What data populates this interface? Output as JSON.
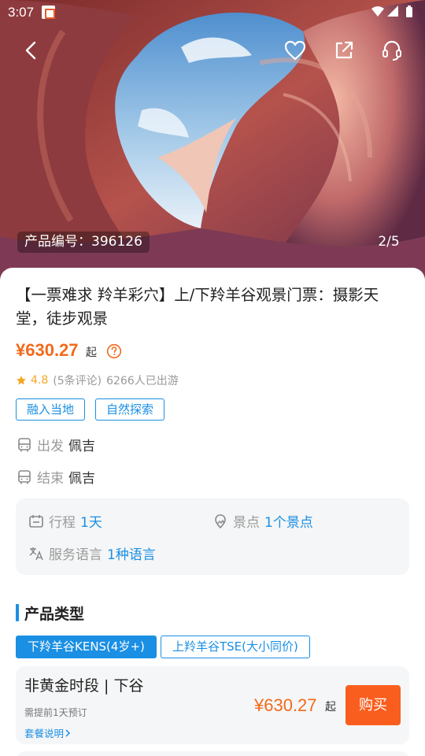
{
  "status_bar": {
    "time": "3:07"
  },
  "hero": {
    "product_code": "产品编号：396126",
    "page_indicator": "2/5"
  },
  "product": {
    "title": "【一票难求 羚羊彩穴】上/下羚羊谷观景门票：摄影天堂，徒步观景",
    "price": "¥630.27",
    "price_suffix": "起",
    "rating": "4.8",
    "reviews": "(5条评论)",
    "travelers": "6266人已出游",
    "tags": [
      "融入当地",
      "自然探索"
    ],
    "start_label": "出发",
    "start_value": "佩吉",
    "end_label": "结束",
    "end_value": "佩吉"
  },
  "info": {
    "trip_label": "行程",
    "trip_value": "1天",
    "spot_label": "景点",
    "spot_value": "1个景点",
    "lang_label": "服务语言",
    "lang_value": "1种语言"
  },
  "product_type": {
    "heading": "产品类型",
    "options": [
      "下羚羊谷KENS(4岁+)",
      "上羚羊谷TSE(大小同价)"
    ],
    "selected_index": 0
  },
  "package": {
    "name": "非黄金时段 | 下谷",
    "note": "需提前1天预订",
    "explain": "套餐说明",
    "price": "¥630.27",
    "price_suffix": "起",
    "buy_label": "购买"
  },
  "colors": {
    "accent_blue": "#1a8fe3",
    "price_orange": "#f26a1b",
    "buy_orange": "#fa5e1e",
    "star_yellow": "#f5a623"
  },
  "icons": [
    "back-icon",
    "heart-icon",
    "share-icon",
    "headset-icon",
    "help-icon",
    "star-icon",
    "bus-icon",
    "calendar-icon",
    "scenic-spot-icon",
    "translate-icon",
    "chevron-right-icon"
  ]
}
